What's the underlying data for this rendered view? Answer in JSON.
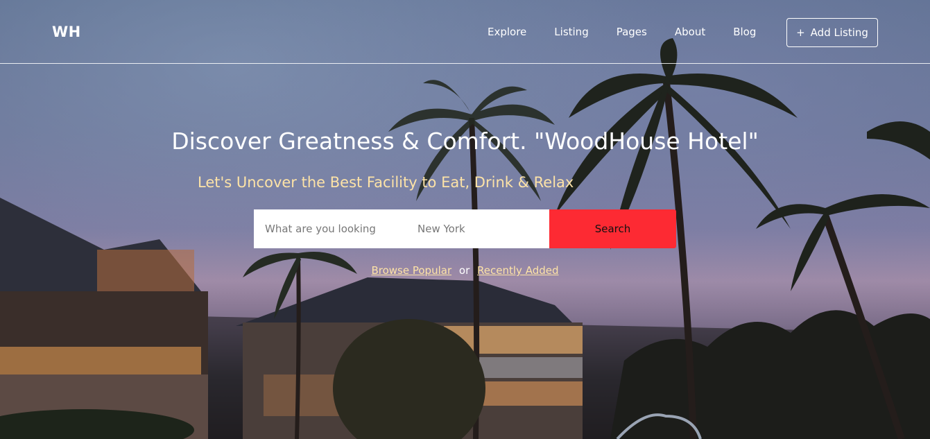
{
  "header": {
    "logo": "WH",
    "nav": [
      "Explore",
      "Listing",
      "Pages",
      "About",
      "Blog"
    ],
    "add_listing_icon": "+",
    "add_listing_label": "Add Listing"
  },
  "hero": {
    "title": "Discover Greatness & Comfort. \"WoodHouse Hotel\"",
    "subtitle": "Let's Uncover the Best Facility to Eat, Drink & Relax"
  },
  "search": {
    "keyword_placeholder": "What are you looking",
    "location_placeholder": "New York",
    "button_label": "Search"
  },
  "links": {
    "browse_popular": "Browse Popular",
    "separator": "or",
    "recently_added": "Recently Added"
  },
  "colors": {
    "search_button": "#fd2a33",
    "subtitle": "#fde3a7"
  }
}
